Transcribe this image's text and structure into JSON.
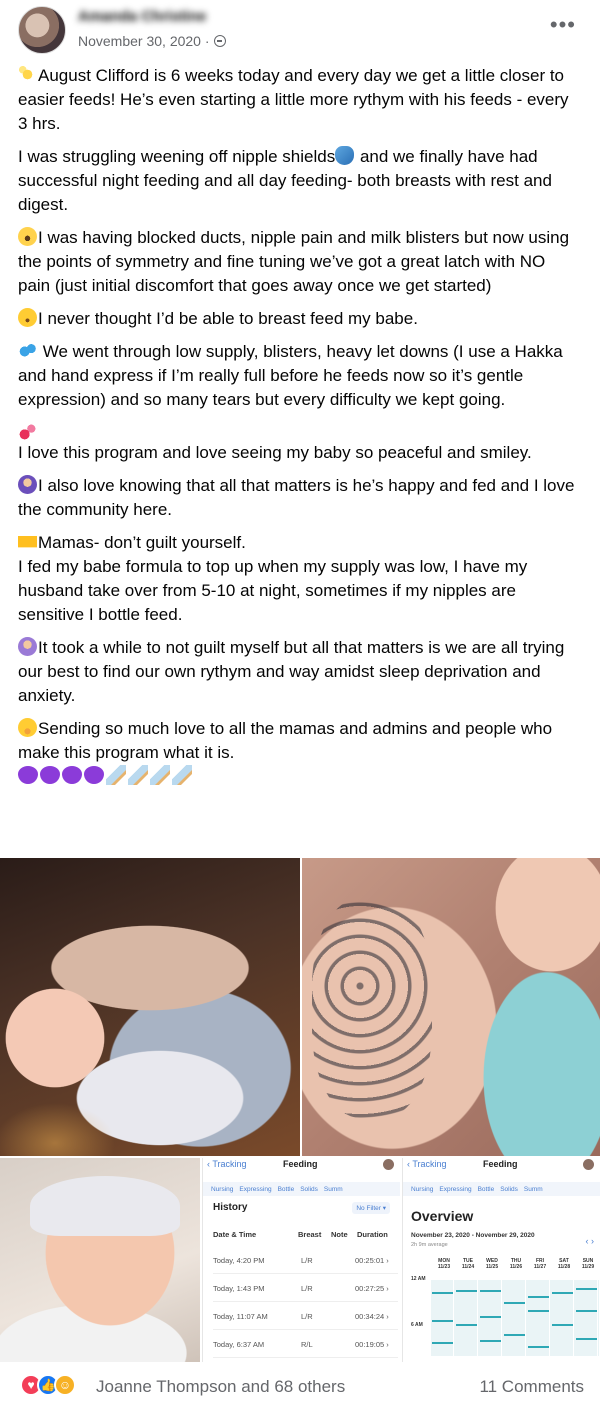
{
  "post": {
    "author": "Amanda Christine",
    "date": "November 30, 2020 ·",
    "privacy_icon": "globe-icon",
    "more_icon": "more-horizontal-icon",
    "paragraphs": [
      "August Clifford is 6 weeks today and every day we get a little closer to easier feeds! He’s even starting a little more rythym with his feeds - every 3 hrs.",
      "I was struggling weening off nipple shields",
      " and we finally have had successful night feeding and all day feeding- both breasts with rest and digest.",
      "I was having blocked ducts, nipple pain and milk blisters but now using the points of symmetry and fine tuning we’ve got a great latch with NO pain (just initial discomfort that goes away once we get started)",
      "I never thought I’d be able to breast feed my babe.",
      " We went through low supply, blisters, heavy let downs (I use a Hakka and hand express if I’m really full before he feeds now so it’s gentle expression) and so many tears but every difficulty we kept going.",
      "I love this program and love seeing my baby so peaceful and smiley.",
      "I also love knowing that all that matters is he’s happy and fed and I love the community here.",
      "Mamas- don’t guilt yourself.",
      "I fed my babe formula to top up when my supply was low, I have my husband take over from 5-10 at night, sometimes if my nipples are sensitive I bottle feed.",
      "It took a while to not guilt myself but all that matters is we are all trying our best to find our own rythym and way amidst sleep deprivation and anxiety.",
      "Sending so much love to all the mamas and admins and people who make this program what it is."
    ]
  },
  "photos": {
    "history_app": {
      "back": "Tracking",
      "title": "Feeding",
      "tabs": [
        "Nursing",
        "Expressing",
        "Bottle",
        "Solids",
        "Summ"
      ],
      "heading": "History",
      "filter": "No Filter ▾",
      "columns": [
        "Date & Time",
        "Breast",
        "Note",
        "Duration"
      ],
      "rows": [
        {
          "time": "Today, 4:20 PM",
          "breast": "L/R",
          "duration": "00:25:01 ›"
        },
        {
          "time": "Today, 1:43 PM",
          "breast": "L/R",
          "duration": "00:27:25 ›"
        },
        {
          "time": "Today, 11:07 AM",
          "breast": "L/R",
          "duration": "00:34:24 ›"
        },
        {
          "time": "Today, 6:37 AM",
          "breast": "R/L",
          "duration": "00:19:05 ›"
        }
      ]
    },
    "overview_app": {
      "back": "Tracking",
      "title": "Feeding",
      "tabs": [
        "Nursing",
        "Expressing",
        "Bottle",
        "Solids",
        "Summ"
      ],
      "heading": "Overview",
      "range": "November 23, 2020 - November 29, 2020",
      "average": "2h 9m average",
      "nav": "‹  ›",
      "days": [
        {
          "d": "MON",
          "n": "11/23"
        },
        {
          "d": "TUE",
          "n": "11/24"
        },
        {
          "d": "WED",
          "n": "11/25"
        },
        {
          "d": "THU",
          "n": "11/26"
        },
        {
          "d": "FRI",
          "n": "11/27"
        },
        {
          "d": "SAT",
          "n": "11/28"
        },
        {
          "d": "SUN",
          "n": "11/29"
        }
      ],
      "label_12am": "12 AM",
      "label_6am": "6 AM"
    }
  },
  "footer": {
    "reactions": [
      "love-icon",
      "like-icon",
      "care-icon"
    ],
    "reacted_by": "Joanne Thompson and 68 others",
    "comments": "11 Comments"
  }
}
